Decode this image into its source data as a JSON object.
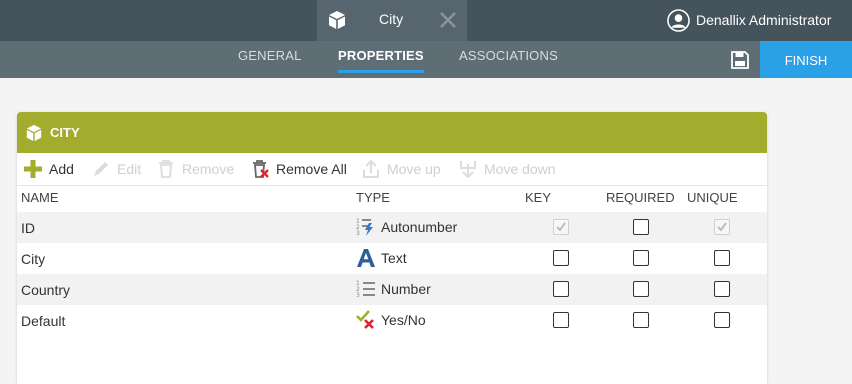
{
  "topbar": {
    "document_tab": {
      "icon": "cube-icon",
      "title": "City",
      "close_icon": "close-icon"
    },
    "user": {
      "icon": "user-avatar-icon",
      "name": "Denallix Administrator"
    }
  },
  "nav": {
    "tabs": [
      {
        "label": "GENERAL",
        "active": false
      },
      {
        "label": "PROPERTIES",
        "active": true
      },
      {
        "label": "ASSOCIATIONS",
        "active": false
      }
    ],
    "save_icon": "save-icon",
    "finish_label": "FINISH"
  },
  "panel": {
    "icon": "cube-icon",
    "title": "CITY",
    "toolbar": [
      {
        "label": "Add",
        "icon": "plus-icon",
        "enabled": true
      },
      {
        "label": "Edit",
        "icon": "pencil-icon",
        "enabled": false
      },
      {
        "label": "Remove",
        "icon": "trash-icon",
        "enabled": false
      },
      {
        "label": "Remove All",
        "icon": "trash-x-icon",
        "enabled": true
      },
      {
        "label": "Move up",
        "icon": "move-up-icon",
        "enabled": false
      },
      {
        "label": "Move down",
        "icon": "move-down-icon",
        "enabled": false
      }
    ],
    "columns": {
      "name": "NAME",
      "type": "TYPE",
      "key": "KEY",
      "required": "REQUIRED",
      "unique": "UNIQUE"
    },
    "rows": [
      {
        "name": "ID",
        "type": "Autonumber",
        "type_icon": "autonumber-icon",
        "key": true,
        "key_enabled": false,
        "required": false,
        "unique": true,
        "unique_enabled": false
      },
      {
        "name": "City",
        "type": "Text",
        "type_icon": "text-a-icon",
        "key": false,
        "key_enabled": true,
        "required": false,
        "unique": false,
        "unique_enabled": true
      },
      {
        "name": "Country",
        "type": "Number",
        "type_icon": "number-list-icon",
        "key": false,
        "key_enabled": true,
        "required": false,
        "unique": false,
        "unique_enabled": true
      },
      {
        "name": "Default",
        "type": "Yes/No",
        "type_icon": "yes-no-icon",
        "key": false,
        "key_enabled": true,
        "required": false,
        "unique": false,
        "unique_enabled": true
      }
    ]
  },
  "colors": {
    "topbar": "#44535c",
    "navbar": "#5f6d75",
    "accent_blue": "#2aa0e6",
    "panel_header": "#a3ac2d"
  }
}
